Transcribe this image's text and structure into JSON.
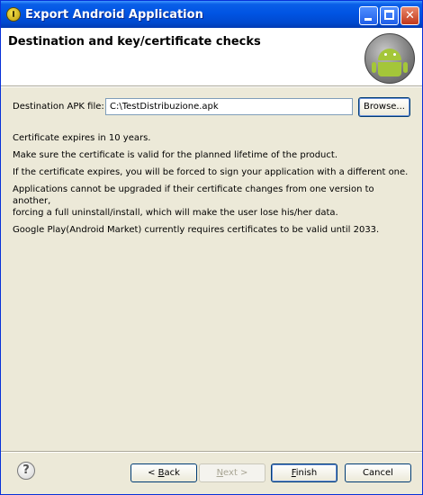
{
  "window": {
    "title": "Export Android Application",
    "controls": {
      "minimize": "",
      "maximize": "",
      "close": "✕"
    }
  },
  "header": {
    "title": "Destination and key/certificate checks"
  },
  "destination": {
    "label": "Destination APK file:",
    "value": "C:\\TestDistribuzione.apk",
    "browse_label": "Browse..."
  },
  "messages": [
    "Certificate expires in 10 years.",
    "Make sure the certificate is valid for the planned lifetime of the product.",
    "If the certificate expires, you will be forced to sign your application with a different one.",
    "Applications cannot be upgraded if their certificate changes from one version to another,",
    "forcing a full uninstall/install, which will make the user lose his/her data.",
    "Google Play(Android Market) currently requires certificates to be valid until 2033."
  ],
  "footer": {
    "help_glyph": "?",
    "back": {
      "prefix": "< ",
      "mnemonic": "B",
      "rest": "ack"
    },
    "next": {
      "mnemonic": "N",
      "rest": "ext >"
    },
    "finish": {
      "mnemonic": "F",
      "rest": "inish"
    },
    "cancel": "Cancel"
  }
}
